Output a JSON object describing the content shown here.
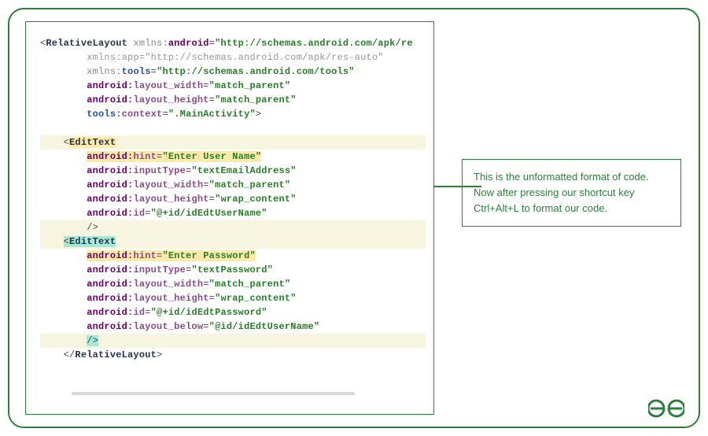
{
  "code": {
    "rl_open": "RelativeLayout",
    "rl_close": "RelativeLayout",
    "et_open": "EditText",
    "ns_xmlns": "xmlns:",
    "ns_android": "android",
    "ns_app": "app",
    "ns_tools": "tools",
    "attr_android_ns": "\"http://schemas.android.com/apk/re",
    "attr_app_ns": "\"http://schemas.android.com/apk/res-auto\"",
    "attr_tools_ns": "\"http://schemas.android.com/tools\"",
    "prefix_android": "android:",
    "prefix_tools": "tools:",
    "attr_layout_width": "layout_width",
    "attr_layout_height": "layout_height",
    "attr_context": "context",
    "attr_hint": "hint",
    "attr_inputType": "inputType",
    "attr_id": "id",
    "attr_layout_below": "layout_below",
    "val_match_parent": "\"match_parent\"",
    "val_wrap_content": "\"wrap_content\"",
    "val_context": "\".MainActivity\"",
    "val_hint_user": "\"Enter User Name\"",
    "val_hint_pass": "\"Enter Password\"",
    "val_inputType_email": "\"textEmailAddress\"",
    "val_inputType_pass": "\"textPassword\"",
    "val_id_user": "\"@+id/idEdtUserName\"",
    "val_id_pass": "\"@+id/idEdtPassword\"",
    "val_below": "\"@id/idEdtUserName\"",
    "close_tag": "/>",
    "gt": ">"
  },
  "annotation": {
    "line1": "This is the unformatted format of code.",
    "line2": "Now after pressing our shortcut key",
    "line3": "Ctrl+Alt+L to format our code."
  },
  "logo_text": "GG"
}
